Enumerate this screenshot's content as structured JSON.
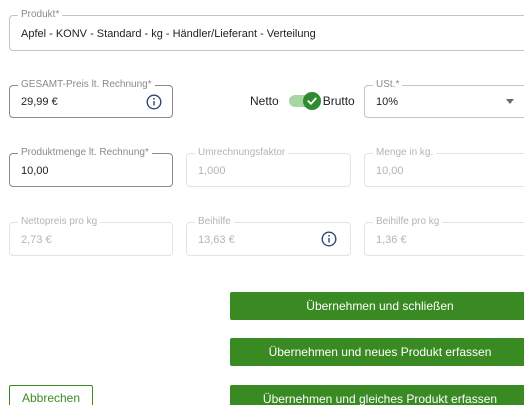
{
  "produkt": {
    "label": "Produkt*",
    "value": "Apfel - KONV - Standard - kg - Händler/Lieferant - Verteilung"
  },
  "gesamt_preis": {
    "label": "GESAMT-Preis lt. Rechnung*",
    "value": "29,99 €"
  },
  "toggle": {
    "left_label": "Netto",
    "right_label": "Brutto",
    "state": "Brutto"
  },
  "ust": {
    "label": "USt.*",
    "value": "10%"
  },
  "produktmenge": {
    "label": "Produktmenge lt. Rechnung*",
    "value": "10,00"
  },
  "umrechnungsfaktor": {
    "label": "Umrechnungsfaktor",
    "value": "1,000"
  },
  "menge_kg": {
    "label": "Menge in kg.",
    "value": "10,00"
  },
  "nettopreis": {
    "label": "Nettopreis pro kg",
    "value": "2,73 €"
  },
  "beihilfe": {
    "label": "Beihilfe",
    "value": "13,63 €"
  },
  "beihilfe_pro_kg": {
    "label": "Beihilfe pro kg",
    "value": "1,36 €"
  },
  "buttons": {
    "save_close": "Übernehmen und schließen",
    "save_new": "Übernehmen und neues Produkt erfassen",
    "save_same": "Übernehmen und gleiches Produkt erfassen",
    "cancel": "Abbrechen"
  },
  "colors": {
    "accent": "#3a8a23",
    "toggle_track": "#a8d5a2",
    "toggle_thumb": "#2e8b2e",
    "info_icon": "#2b4a6f"
  },
  "icons": {
    "info": "info-icon",
    "check": "check-icon",
    "dropdown": "chevron-down-icon"
  }
}
